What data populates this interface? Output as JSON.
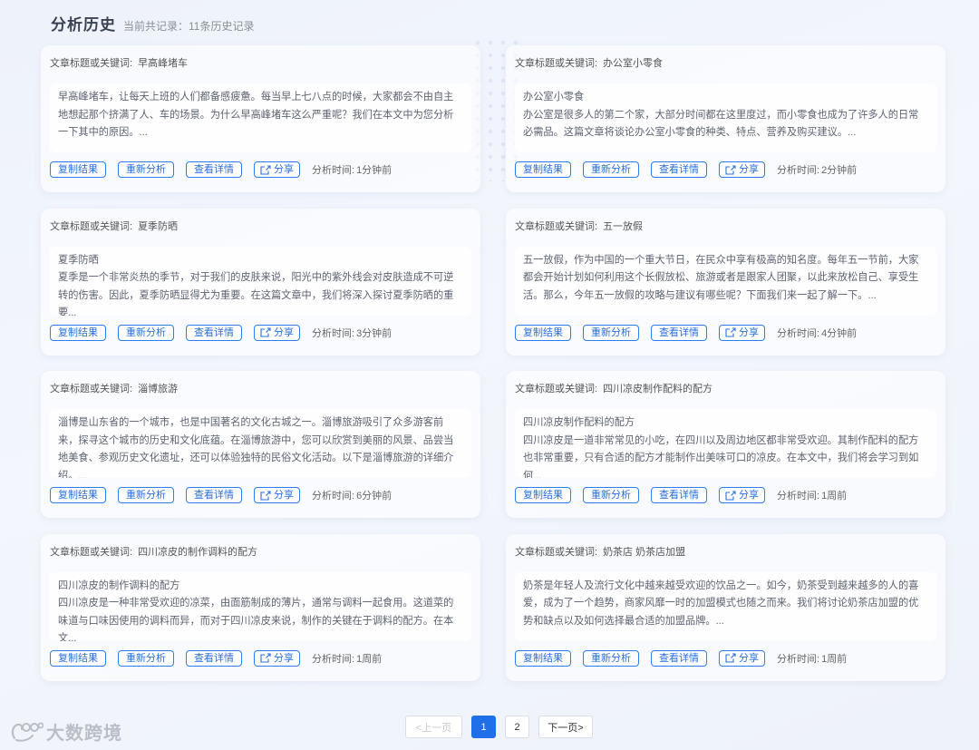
{
  "header": {
    "title": "分析历史",
    "subtitle": "当前共记录：11条历史记录"
  },
  "card_labels": {
    "keyword_prefix": "文章标题或关键词:",
    "copy": "复制结果",
    "reanalyze": "重新分析",
    "detail": "查看详情",
    "share": "分享",
    "time_prefix": "分析时间:"
  },
  "cards": [
    {
      "keyword": "早高峰堵车",
      "subtitle": "",
      "content": "早高峰堵车，让每天上班的人们都备感疲惫。每当早上七八点的时候，大家都会不由自主地想起那个挤满了人、车的场景。为什么早高峰堵车这么严重呢？我们在本文中为您分析一下其中的原因。...",
      "time": "1分钟前"
    },
    {
      "keyword": "办公室小零食",
      "subtitle": "办公室小零食",
      "content": "办公室是很多人的第二个家，大部分时间都在这里度过，而小零食也成为了许多人的日常必需品。这篇文章将谈论办公室小零食的种类、特点、营养及购买建议。...",
      "time": "2分钟前"
    },
    {
      "keyword": "夏季防晒",
      "subtitle": "夏季防晒",
      "content": "夏季是一个非常炎热的季节，对于我们的皮肤来说，阳光中的紫外线会对皮肤造成不可逆转的伤害。因此，夏季防晒显得尤为重要。在这篇文章中，我们将深入探讨夏季防晒的重要...",
      "time": "3分钟前"
    },
    {
      "keyword": "五一放假",
      "subtitle": "",
      "content": "五一放假，作为中国的一个重大节日，在民众中享有极高的知名度。每年五一节前，大家都会开始计划如何利用这个长假放松、旅游或者是跟家人团聚，以此来放松自己、享受生活。那么，今年五一放假的攻略与建议有哪些呢？下面我们来一起了解一下。...",
      "time": "4分钟前"
    },
    {
      "keyword": "淄博旅游",
      "subtitle": "",
      "content": "淄博是山东省的一个城市，也是中国著名的文化古城之一。淄博旅游吸引了众多游客前来，探寻这个城市的历史和文化底蕴。在淄博旅游中，您可以欣赏到美丽的风景、品尝当地美食、参观历史文化遗址，还可以体验独特的民俗文化活动。以下是淄博旅游的详细介绍。...",
      "time": "6分钟前"
    },
    {
      "keyword": "四川凉皮制作配料的配方",
      "subtitle": "四川凉皮制作配料的配方",
      "content": "四川凉皮是一道非常常见的小吃，在四川以及周边地区都非常受欢迎。其制作配料的配方也非常重要，只有合适的配方才能制作出美味可口的凉皮。在本文中，我们将会学习到如何...",
      "time": "1周前"
    },
    {
      "keyword": "四川凉皮的制作调料的配方",
      "subtitle": "四川凉皮的制作调料的配方",
      "content": "四川凉皮是一种非常受欢迎的凉菜，由面筋制成的薄片，通常与调料一起食用。这道菜的味道与口味因使用的调料而异，而对于四川凉皮来说，制作的关键在于调料的配方。在本文...",
      "time": "1周前"
    },
    {
      "keyword": "奶茶店 奶茶店加盟",
      "subtitle": "",
      "content": "奶茶是年轻人及流行文化中越来越受欢迎的饮品之一。如今，奶茶受到越来越多的人的喜爱，成为了一个趋势，商家风靡一时的加盟模式也随之而来。我们将讨论奶茶店加盟的优势和缺点以及如何选择最合适的加盟品牌。...",
      "time": "1周前"
    }
  ],
  "pagination": {
    "prev": "<上一页",
    "pages": [
      "1",
      "2"
    ],
    "active_page": "1",
    "next": "下一页>"
  },
  "logo": {
    "text": "大数跨境"
  },
  "colors": {
    "accent": "#1e6fe8",
    "button_border": "#2a7ef3"
  }
}
